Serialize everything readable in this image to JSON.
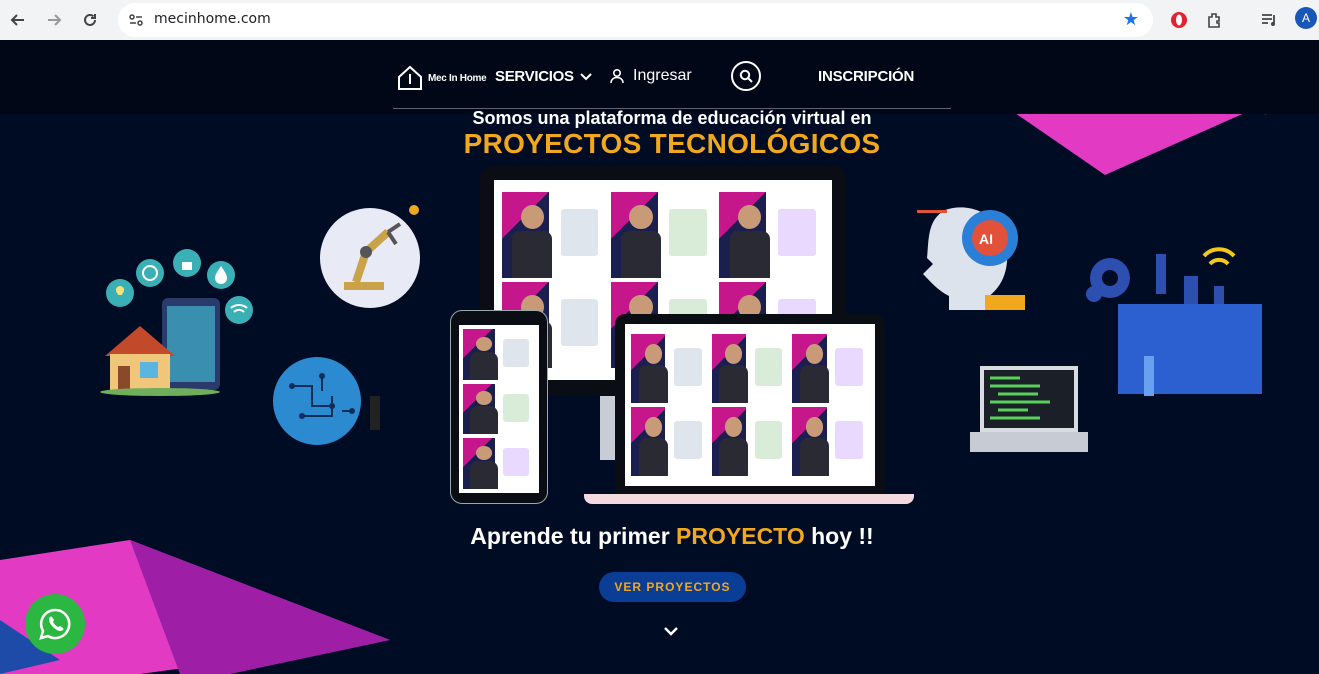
{
  "browser": {
    "url": "mecinhome.com",
    "avatar_letter": "A",
    "icons": [
      "back-icon",
      "forward-icon",
      "reload-icon",
      "site-info-icon",
      "star-icon",
      "opera-extension-icon",
      "extensions-icon",
      "media-icon"
    ]
  },
  "header": {
    "logo_text": "Mec In Home",
    "servicios": "SERVICIOS",
    "ingresar": "Ingresar",
    "inscripcion": "INSCRIPCIÓN"
  },
  "hero": {
    "line1": "Somos una plataforma de educación virtual en",
    "line2": "PROYECTOS TECNOLÓGICOS",
    "cta_prefix": "Aprende  tu primer ",
    "cta_accent": "PROYECTO",
    "cta_suffix": " hoy !!",
    "button": "VER PROYECTOS"
  },
  "colors": {
    "background": "#000c24",
    "accent_gold": "#f2a81d",
    "button_blue": "#0a3d96",
    "magenta": "#e23ac2",
    "whatsapp_green": "#2bb741"
  }
}
